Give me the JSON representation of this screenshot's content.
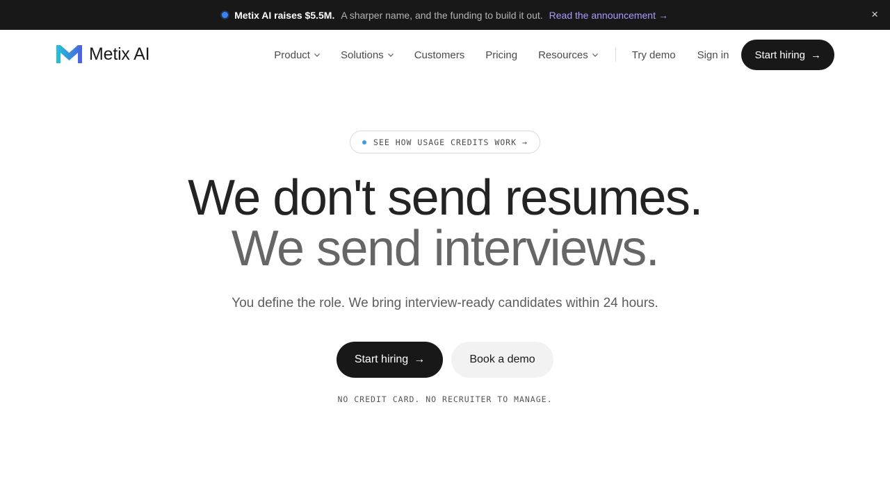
{
  "announcement": {
    "headline": "Metix AI raises $5.5M.",
    "subtext": "A sharper name, and the funding to build it out.",
    "link_label": "Read the announcement →",
    "close_label": "×",
    "dot_color": "#3b82f6"
  },
  "nav": {
    "brand": "Metix AI",
    "items": [
      {
        "label": "Product",
        "icon": "chevron-down-icon"
      },
      {
        "label": "Solutions",
        "icon": "chevron-down-icon"
      },
      {
        "label": "Customers"
      },
      {
        "label": "Pricing"
      },
      {
        "label": "Resources",
        "icon": "chevron-down-icon"
      }
    ],
    "try_demo": "Try demo",
    "sign_in": "Sign in",
    "start_hiring": "Start hiring",
    "arrow": "→"
  },
  "hero": {
    "pill_label": "SEE HOW USAGE CREDITS WORK",
    "pill_arrow": "→",
    "headline_1": "We don't send resumes.",
    "headline_2": "We send interviews.",
    "subtitle": "You define the role. We bring interview-ready candidates within 24 hours.",
    "primary_cta": "Start hiring",
    "cta_arrow": "→",
    "secondary_cta": "Book a demo",
    "note": "NO CREDIT CARD. NO RECRUITER TO MANAGE."
  },
  "colors": {
    "dark": "#181818",
    "accent_link": "#a99cff",
    "logo_gradient_start": "#22c4d8",
    "logo_gradient_end": "#4c5fe0"
  }
}
